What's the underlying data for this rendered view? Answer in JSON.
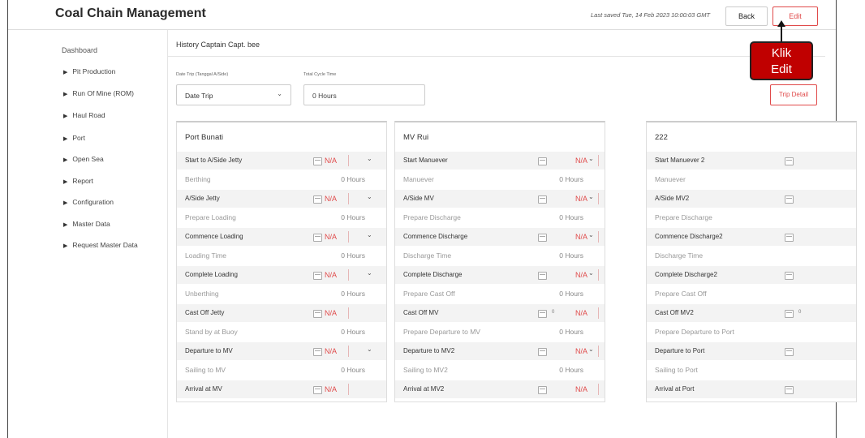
{
  "header": {
    "title": "Coal Chain Management",
    "last_saved": "Last saved Tue, 14 Feb 2023 10:00:03 GMT",
    "back_label": "Back",
    "edit_label": "Edit"
  },
  "sidebar": {
    "dashboard": "Dashboard",
    "items": [
      {
        "label": "Pit Production"
      },
      {
        "label": "Run Of Mine (ROM)"
      },
      {
        "label": "Haul Road"
      },
      {
        "label": "Port"
      },
      {
        "label": "Open Sea"
      },
      {
        "label": "Report"
      },
      {
        "label": "Configuration"
      },
      {
        "label": "Master Data"
      },
      {
        "label": "Request Master Data"
      }
    ]
  },
  "main": {
    "history_title": "History Captain Capt. bee",
    "date_trip_label": "Date Trip (Tanggal A/Side)",
    "total_cycle_label": "Total Cycle Time",
    "date_trip_value": "Date Trip",
    "total_cycle_value": "0 Hours",
    "trip_detail_label": "Trip Detail"
  },
  "cards": [
    {
      "title": "Port Bunati",
      "rows": [
        {
          "label": "Start to A/Side Jetty",
          "value": "N/A"
        },
        {
          "label": "Berthing",
          "duration": "0 Hours"
        },
        {
          "label": "A/Side Jetty",
          "value": "N/A"
        },
        {
          "label": "Prepare Loading",
          "duration": "0 Hours"
        },
        {
          "label": "Commence Loading",
          "value": "N/A"
        },
        {
          "label": "Loading Time",
          "duration": "0 Hours"
        },
        {
          "label": "Complete Loading",
          "value": "N/A"
        },
        {
          "label": "Unberthing",
          "duration": "0 Hours"
        },
        {
          "label": "Cast Off Jetty",
          "value": "N/A"
        },
        {
          "label": "Stand by at Buoy",
          "duration": "0 Hours"
        },
        {
          "label": "Departure to MV",
          "value": "N/A"
        },
        {
          "label": "Sailing to MV",
          "duration": "0 Hours"
        },
        {
          "label": "Arrival at MV",
          "value": "N/A"
        }
      ]
    },
    {
      "title": "MV Rui",
      "rows": [
        {
          "label": "Start Manuever",
          "value": "N/A"
        },
        {
          "label": "Manuever",
          "duration": "0 Hours"
        },
        {
          "label": "A/Side MV",
          "value": "N/A"
        },
        {
          "label": "Prepare Discharge",
          "duration": "0 Hours"
        },
        {
          "label": "Commence Discharge",
          "value": "N/A"
        },
        {
          "label": "Discharge Time",
          "duration": "0 Hours"
        },
        {
          "label": "Complete Discharge",
          "value": "N/A"
        },
        {
          "label": "Prepare Cast Off",
          "duration": "0 Hours"
        },
        {
          "label": "Cast Off MV",
          "value": "N/A",
          "zero": "0"
        },
        {
          "label": "Prepare Departure to MV",
          "duration": "0 Hours"
        },
        {
          "label": "Departure to MV2",
          "value": "N/A"
        },
        {
          "label": "Sailing to MV2",
          "duration": "0 Hours"
        },
        {
          "label": "Arrival at MV2",
          "value": "N/A"
        }
      ]
    },
    {
      "title": "222",
      "rows": [
        {
          "label": "Start Manuever 2"
        },
        {
          "label": "Manuever",
          "duration": ""
        },
        {
          "label": "A/Side MV2"
        },
        {
          "label": "Prepare Discharge",
          "duration": ""
        },
        {
          "label": "Commence Discharge2"
        },
        {
          "label": "Discharge Time",
          "duration": ""
        },
        {
          "label": "Complete Discharge2"
        },
        {
          "label": "Prepare Cast Off",
          "duration": ""
        },
        {
          "label": "Cast Off MV2",
          "zero": "0"
        },
        {
          "label": "Prepare Departure to Port",
          "duration": ""
        },
        {
          "label": "Departure to Port"
        },
        {
          "label": "Sailing to Port",
          "duration": ""
        },
        {
          "label": "Arrival at Port"
        }
      ]
    }
  ],
  "callout": {
    "line1": "Klik",
    "line2": "Edit"
  }
}
